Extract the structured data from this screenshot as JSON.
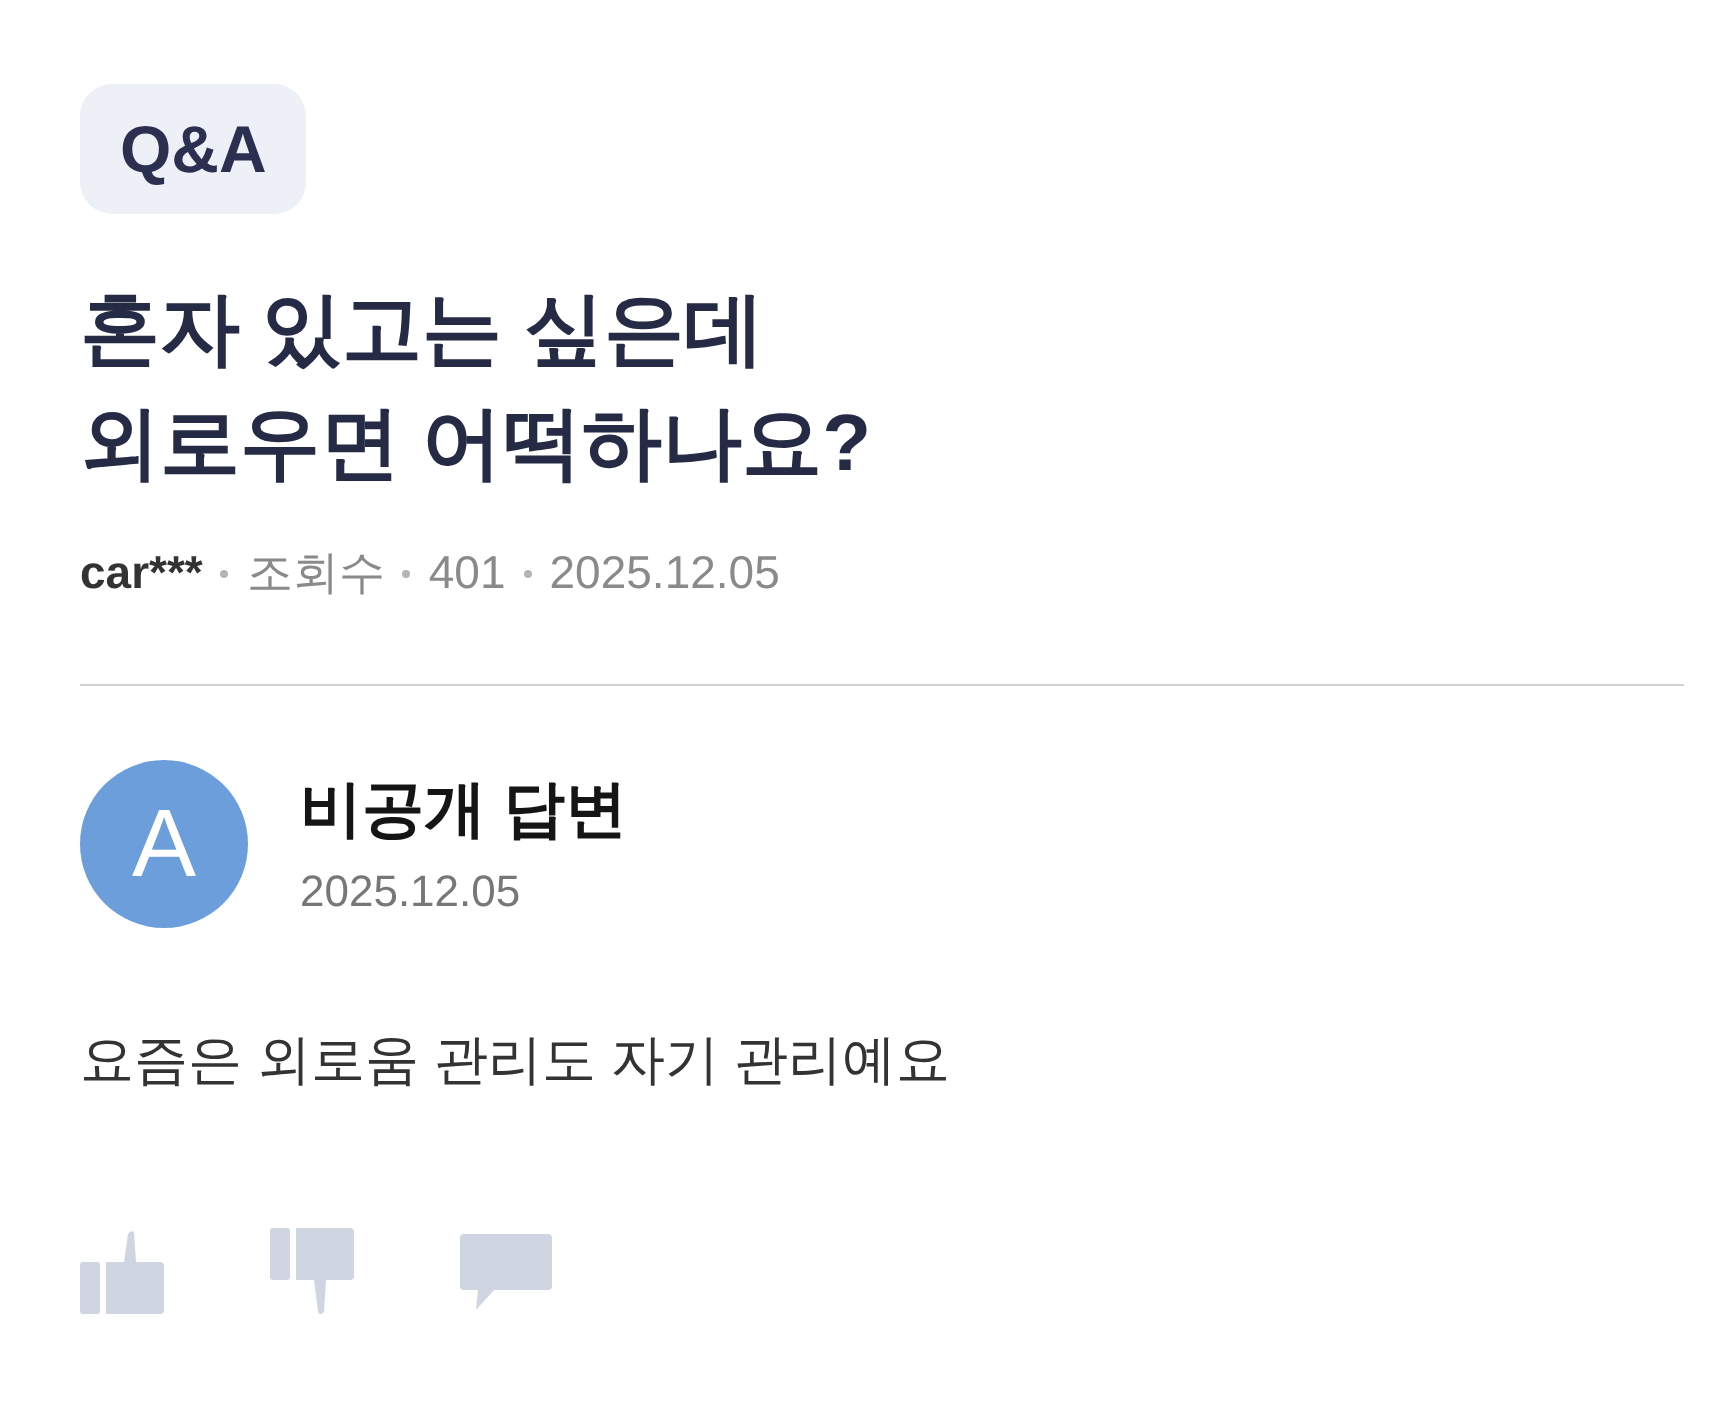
{
  "category_badge": "Q&A",
  "question": {
    "title": "혼자 있고는 싶은데\n외로우면 어떡하나요?",
    "author": "car***",
    "meta": [
      "조회수",
      "401",
      "2025.12.05"
    ]
  },
  "answer": {
    "avatar_letter": "A",
    "author": "비공개 답변",
    "date": "2025.12.05",
    "body": "요즘은 외로움 관리도 자기 관리예요"
  }
}
